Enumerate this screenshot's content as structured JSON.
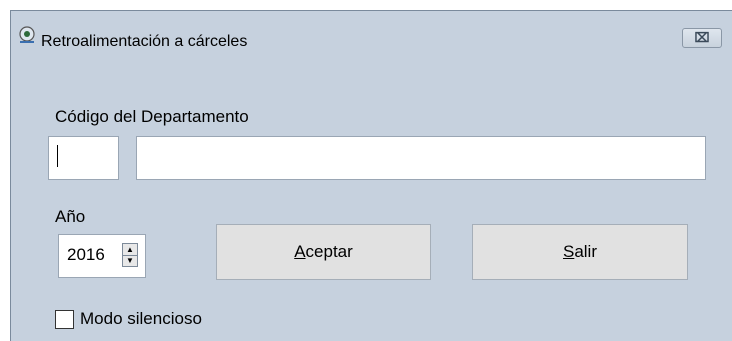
{
  "window": {
    "title": "Retroalimentación a cárceles",
    "close_symbol": "⌧"
  },
  "form": {
    "department_label": "Código del Departamento",
    "department_code_value": "",
    "department_name_value": "",
    "year_label": "Año",
    "year_value": "2016",
    "accept_button": {
      "mnemonic": "A",
      "rest": "ceptar"
    },
    "exit_button": {
      "mnemonic": "S",
      "rest": "alir"
    },
    "silent_mode_label": "Modo silencioso",
    "silent_mode_checked": false
  },
  "icons": {
    "app": "window-app-icon",
    "close": "close-icon",
    "spin_up": "spin-up-icon",
    "spin_down": "spin-down-icon"
  }
}
